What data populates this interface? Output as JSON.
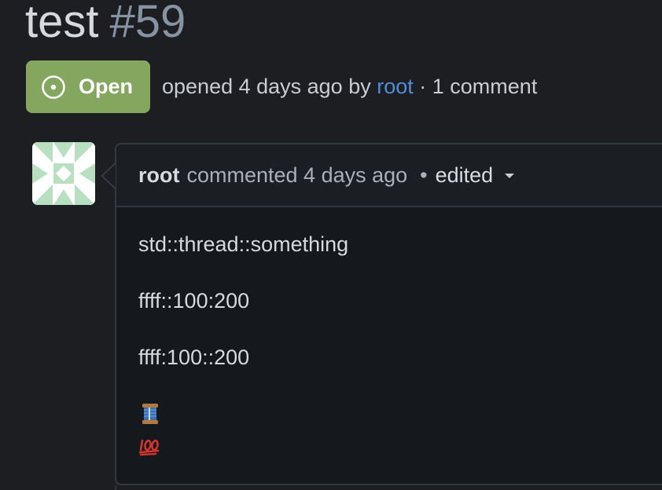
{
  "issue": {
    "title": "test",
    "number": "#59",
    "status_label": "Open",
    "meta_prefix": "opened 4 days ago by",
    "author": "root",
    "meta_suffix": "· 1 comment"
  },
  "comment": {
    "author": "root",
    "action": "commented 4 days ago",
    "dot": "•",
    "edited_label": "edited",
    "body": [
      "std::thread::something",
      "ffff::100:200",
      "ffff:100::200"
    ],
    "emojis": [
      "thread-spool-icon",
      "hundred-points-icon"
    ]
  },
  "colors": {
    "open_badge": "#84a65f",
    "link": "#4f8fd6",
    "background": "#1c1e22"
  }
}
